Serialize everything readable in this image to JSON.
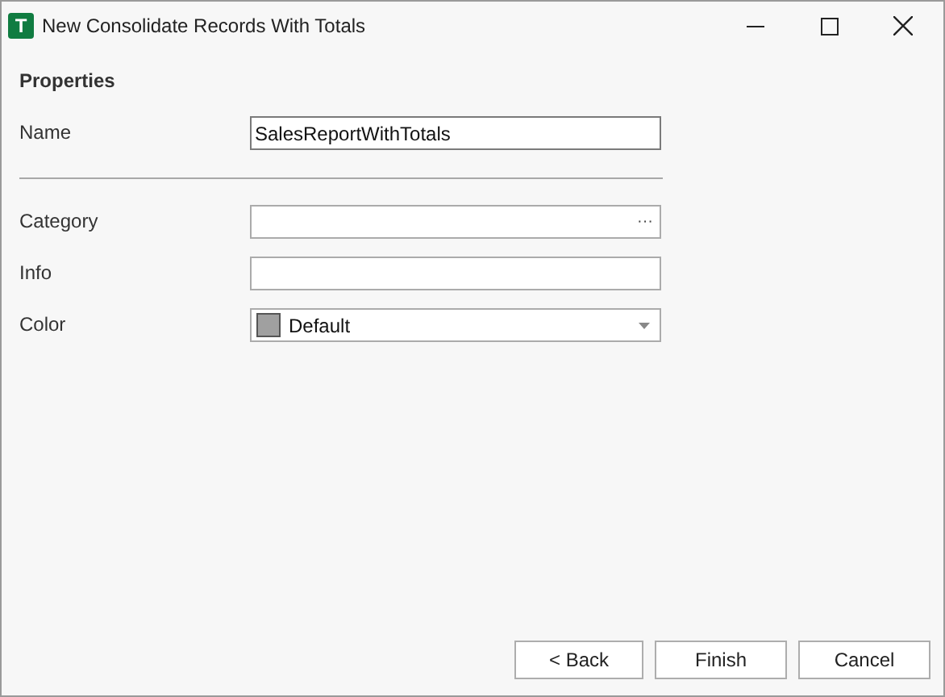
{
  "window": {
    "title": "New Consolidate Records With Totals",
    "app_icon": "T"
  },
  "section": {
    "title": "Properties"
  },
  "fields": [
    {
      "kind": "text",
      "label": "Name",
      "value": "SalesReportWithTotals",
      "focused": true,
      "divider_after": true
    },
    {
      "kind": "browse",
      "label": "Category",
      "button_text": "···",
      "focused": false,
      "divider_after": false
    },
    {
      "kind": "text",
      "label": "Info",
      "focused": false,
      "divider_after": false
    },
    {
      "kind": "dropdown",
      "label": "Color",
      "value": "Default",
      "color": "#a0a0a0",
      "focused": false,
      "divider_after": false
    }
  ],
  "buttons": [
    "< Back",
    "Finish",
    "Cancel"
  ]
}
